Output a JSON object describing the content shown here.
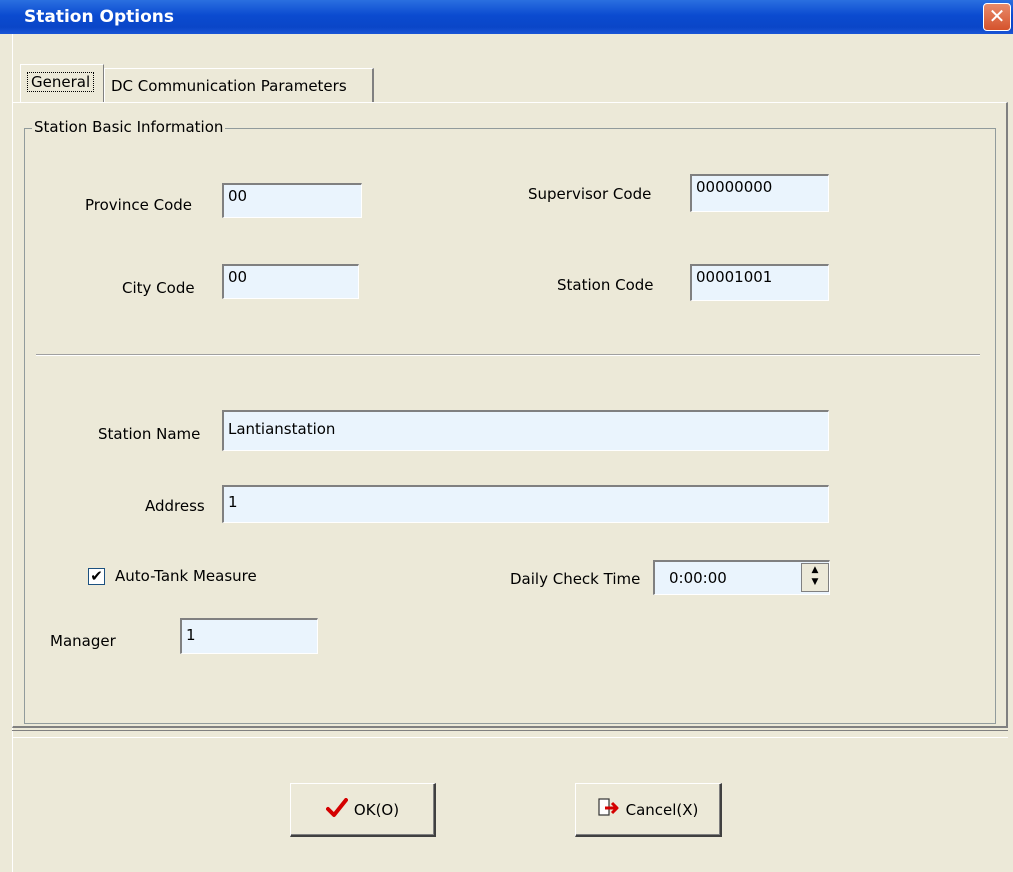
{
  "window": {
    "title": "Station Options",
    "close_glyph": "✕"
  },
  "tabs": [
    {
      "label": "General"
    },
    {
      "label": "DC Communication Parameters"
    }
  ],
  "group": {
    "label": "Station Basic Information"
  },
  "fields": {
    "province_code": {
      "label": "Province Code",
      "value": "00"
    },
    "city_code": {
      "label": "City Code",
      "value": "00"
    },
    "supervisor_code": {
      "label": "Supervisor Code",
      "value": "00000000"
    },
    "station_code": {
      "label": "Station Code",
      "value": "00001001"
    },
    "station_name": {
      "label": "Station Name",
      "value": "Lantianstation"
    },
    "address": {
      "label": "Address",
      "value": "1"
    },
    "manager": {
      "label": "Manager",
      "value": "1"
    },
    "daily_check_time": {
      "label": "Daily Check Time",
      "value": "0:00:00"
    }
  },
  "auto_tank": {
    "label": "Auto-Tank Measure",
    "checked": true,
    "check_glyph": "✔"
  },
  "buttons": {
    "ok": {
      "label": "OK(O)",
      "icon": "checkmark-icon"
    },
    "cancel": {
      "label": "Cancel(X)",
      "icon": "cancel-door-icon"
    }
  },
  "colors": {
    "titlebar": "#0a46c8",
    "field_bg": "#eaf4fd",
    "dialog_bg": "#ece9d8",
    "close": "#d5532c",
    "ok_check": "#d40000"
  }
}
